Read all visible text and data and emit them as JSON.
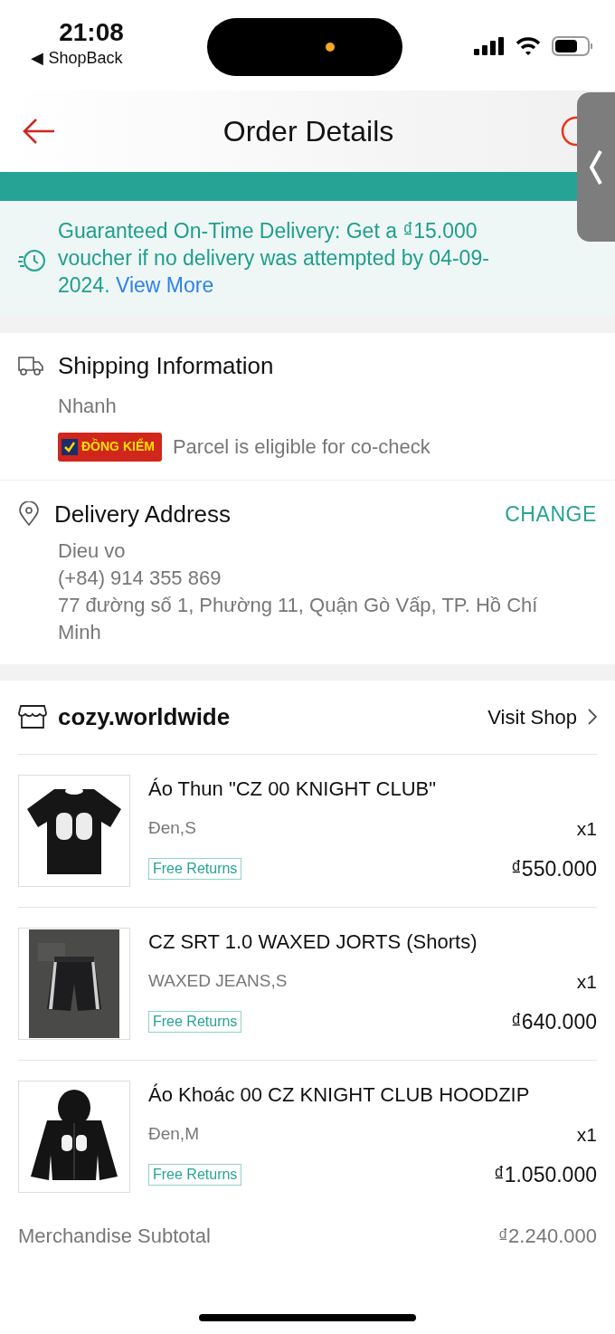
{
  "status_bar": {
    "time": "21:08",
    "back_app": "◀ ShopBack"
  },
  "header": {
    "title": "Order Details"
  },
  "guarantee": {
    "text": "Guaranteed On-Time Delivery: Get a ₫15.000 voucher if no delivery was attempted by 04-09-2024.",
    "link": "View More"
  },
  "shipping": {
    "title": "Shipping Information",
    "method": "Nhanh",
    "badge": "ĐỒNG KIỂM",
    "badge_checked": true,
    "note": "Parcel is eligible for co-check"
  },
  "address": {
    "title": "Delivery Address",
    "action": "CHANGE",
    "name": "Dieu vo",
    "phone": "(+84) 914 355 869",
    "street": "77 đường số 1, Phường 11, Quận Gò Vấp, TP. Hồ Chí Minh"
  },
  "shop": {
    "name": "cozy.worldwide",
    "action": "Visit Shop"
  },
  "items": [
    {
      "kind": "tshirt",
      "name": "Áo Thun \"CZ 00 KNIGHT CLUB\"",
      "variant": "Đen,S",
      "qty": "x1",
      "tag": "Free Returns",
      "price": "₫550.000"
    },
    {
      "kind": "shorts",
      "name": "CZ SRT 1.0 WAXED JORTS (Shorts)",
      "variant": "WAXED JEANS,S",
      "qty": "x1",
      "tag": "Free Returns",
      "price": "₫640.000"
    },
    {
      "kind": "hoodie",
      "name": "Áo Khoác 00 CZ KNIGHT CLUB HOODZIP",
      "variant": "Đen,M",
      "qty": "x1",
      "tag": "Free Returns",
      "price": "₫1.050.000"
    }
  ],
  "subtotal": {
    "label": "Merchandise Subtotal",
    "value": "₫2.240.000"
  }
}
